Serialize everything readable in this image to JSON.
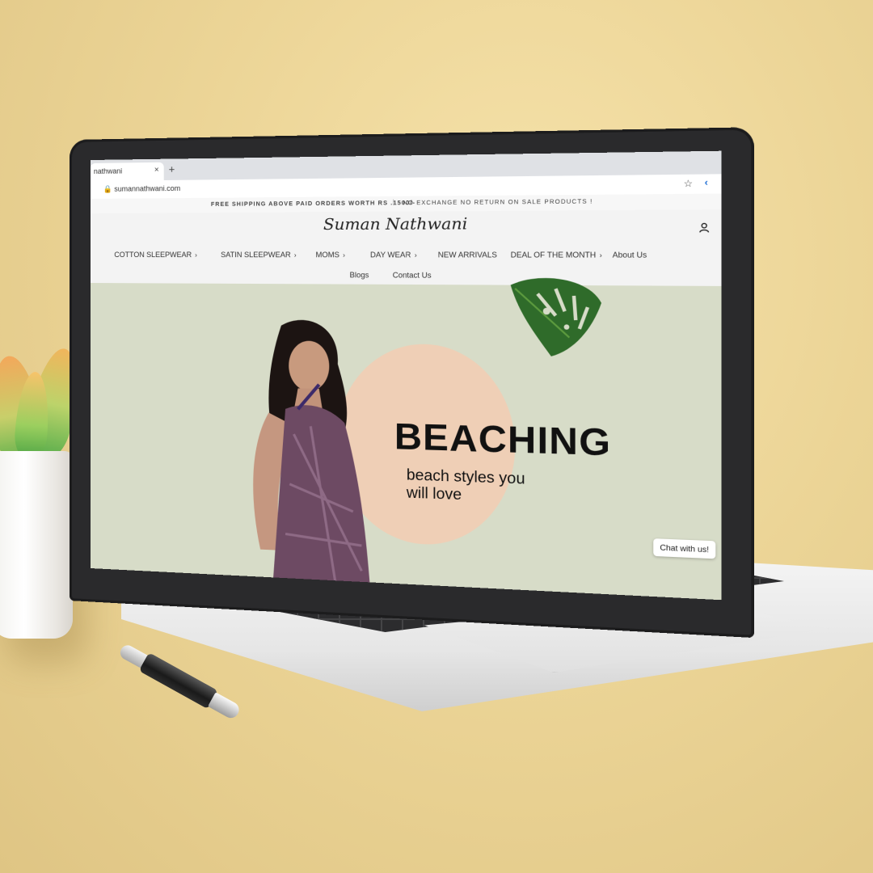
{
  "browser": {
    "tab_title": "nathwani",
    "tab_close": "×",
    "new_tab": "+",
    "url": "sumannathwani.com",
    "lock_icon": "lock-icon",
    "star_icon": "star-icon"
  },
  "announcement": {
    "left": "FREE SHIPPING ABOVE PAID ORDERS WORTH RS .1500/-",
    "separator": "|",
    "right": "NO EXCHANGE NO RETURN ON SALE PRODUCTS !"
  },
  "header": {
    "logo": "Suman Nathwani",
    "account_icon": "user-icon"
  },
  "nav": {
    "row1": [
      {
        "label": "COTTON SLEEPWEAR",
        "has_chevron": true
      },
      {
        "label": "SATIN SLEEPWEAR",
        "has_chevron": true
      },
      {
        "label": "MOMS",
        "has_chevron": true
      },
      {
        "label": "DAY WEAR",
        "has_chevron": true
      },
      {
        "label": "NEW ARRIVALS",
        "has_chevron": false
      },
      {
        "label": "DEAL OF THE MONTH",
        "has_chevron": true
      },
      {
        "label": "About Us",
        "has_chevron": false
      }
    ],
    "row2": [
      {
        "label": "Blogs"
      },
      {
        "label": "Contact Us"
      }
    ],
    "chevron": "›"
  },
  "hero": {
    "title": "BEACHING",
    "subtitle": "beach styles you will love",
    "background_color": "#d7dcc8",
    "circle_color": "#efcfb6"
  },
  "chat": {
    "label": "Chat with us!"
  }
}
